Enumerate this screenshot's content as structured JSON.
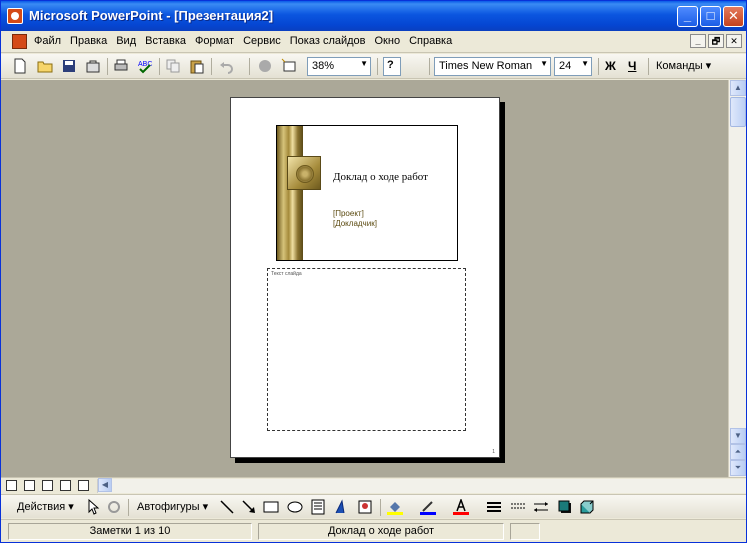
{
  "window": {
    "title": "Microsoft PowerPoint - [Презентация2]",
    "min_label": "_",
    "max_label": "□",
    "close_label": "✕"
  },
  "menu": {
    "items": [
      "Файл",
      "Правка",
      "Вид",
      "Вставка",
      "Формат",
      "Сервис",
      "Показ слайдов",
      "Окно",
      "Справка"
    ],
    "mdi_min": "_",
    "mdi_restore": "🗗",
    "mdi_close": "✕"
  },
  "toolbar": {
    "zoom": "38%",
    "font_name": "Times New Roman",
    "font_size": "24",
    "bold_label": "Ж",
    "underline_label": "Ч",
    "commands_label": "Команды",
    "help_label": "?"
  },
  "slide": {
    "title": "Доклад о ходе работ",
    "subtitle_line1": "[Проект]",
    "subtitle_line2": "[Докладчик]"
  },
  "notes": {
    "placeholder": "Текст слайда",
    "page_number": "1"
  },
  "drawing": {
    "actions_label": "Действия",
    "autoshapes_label": "Автофигуры"
  },
  "status": {
    "notes_page": "Заметки 1 из 10",
    "design": "Доклад о ходе работ"
  },
  "colors": {
    "titlebar": "#0a5ae8",
    "workspace": "#aba898",
    "fill_yellow": "#ffff00",
    "line_blue": "#0000ff",
    "font_red": "#ff0000"
  }
}
